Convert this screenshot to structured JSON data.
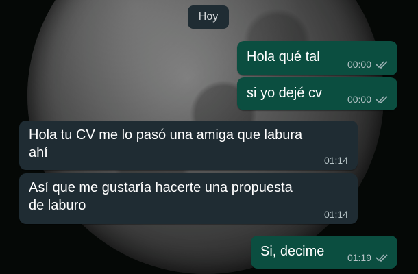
{
  "date_label": "Hoy",
  "messages": [
    {
      "text_lines": [
        "Hola qué tal"
      ],
      "time": "00:00",
      "direction": "out",
      "status": "read"
    },
    {
      "text_lines": [
        "si yo dejé cv"
      ],
      "time": "00:00",
      "direction": "out",
      "status": "read"
    },
    {
      "text_lines": [
        "Hola tu CV me lo pasó una amiga que labura",
        "ahí"
      ],
      "time": "01:14",
      "direction": "in"
    },
    {
      "text_lines": [
        "Así que me gustaría hacerte una propuesta",
        "de laburo"
      ],
      "time": "01:14",
      "direction": "in"
    },
    {
      "text_lines": [
        "Si, decime"
      ],
      "time": "01:19",
      "direction": "out",
      "status": "read"
    }
  ],
  "icons": {
    "read_receipt": "double-check-icon"
  },
  "colors": {
    "outgoing_bubble": "#0b4e40",
    "incoming_bubble": "#1f2c33",
    "timestamp": "#b7c4c7",
    "tick_read": "#9fb3b6"
  }
}
